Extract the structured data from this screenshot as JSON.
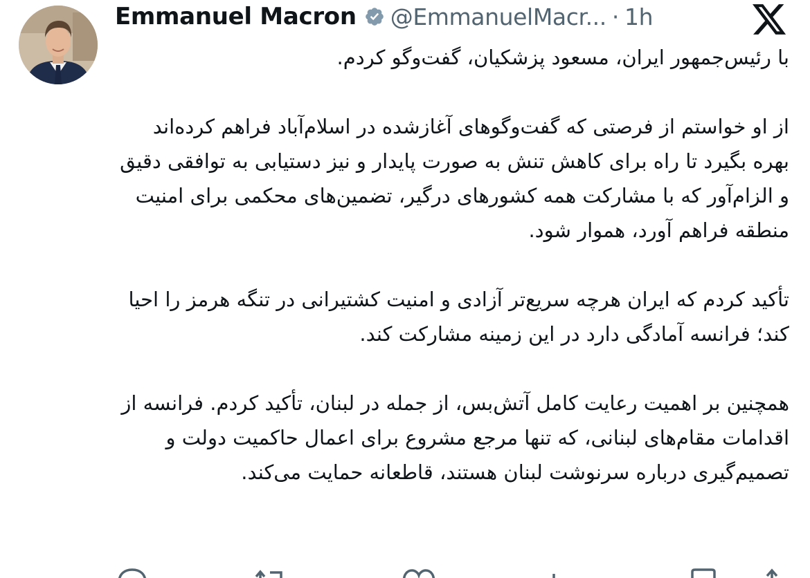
{
  "author": {
    "name": "Emmanuel Macron",
    "handle": "@EmmanuelMacr...",
    "separator": "·",
    "time": "1h"
  },
  "tweet": {
    "paragraphs": [
      "با رئیس‌جمهور ایران، مسعود پزشکیان، گفت‌وگو کردم.",
      "از او خواستم از فرصتی که گفت‌وگوهای آغازشده در اسلام‌آباد فراهم کرده‌اند بهره بگیرد تا راه برای کاهش تنش به صورت پایدار و نیز دستیابی به توافقی دقیق و الزام‌آور که با مشارکت همه کشورهای درگیر، تضمین‌های محکمی برای امنیت منطقه فراهم آورد، هموار شود.",
      "تأکید کردم که ایران هرچه سریع‌تر آزادی و امنیت کشتیرانی در تنگه هرمز را احیا کند؛ فرانسه آمادگی دارد در این زمینه مشارکت کند.",
      "همچنین بر اهمیت رعایت کامل آتش‌بس، از جمله در لبنان، تأکید کردم. فرانسه از اقدامات مقام‌های لبنانی، که تنها مرجع مشروع برای اعمال حاکمیت دولت و تصمیم‌گیری درباره سرنوشت لبنان هستند، قاطعانه حمایت می‌کند."
    ]
  },
  "icons": {
    "verified": "verified-badge-icon",
    "platform": "x-logo-icon",
    "actions": [
      "reply-icon",
      "retweet-icon",
      "like-icon",
      "views-icon",
      "bookmark-icon",
      "share-icon"
    ]
  },
  "colors": {
    "text": "#0f1419",
    "secondary": "#536471",
    "verified_badge": "#829aab"
  }
}
